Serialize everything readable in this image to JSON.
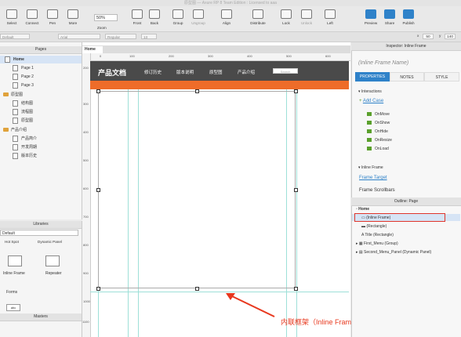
{
  "window": {
    "title": "原型图 — Axure RP 8 Team Edition : Licensed to aaa"
  },
  "toolbar": {
    "items": [
      {
        "label": "Select"
      },
      {
        "label": "Connect"
      },
      {
        "label": "Pen"
      },
      {
        "label": "More"
      },
      {
        "label": "Zoom"
      },
      {
        "label": "Front"
      },
      {
        "label": "Back"
      },
      {
        "label": "Group"
      },
      {
        "label": "Ungroup"
      },
      {
        "label": "Align"
      },
      {
        "label": "Distribute"
      },
      {
        "label": "Lock"
      },
      {
        "label": "Unlock"
      },
      {
        "label": "Left"
      },
      {
        "label": "Preview"
      },
      {
        "label": "Share"
      },
      {
        "label": "Publish"
      }
    ],
    "zoom_value": "50%"
  },
  "formatbar": {
    "style": "Default",
    "font": "Arial",
    "weight": "Regular",
    "size": "13",
    "x_label": "x",
    "x_value": "50",
    "y_label": "y",
    "y_value": "140"
  },
  "pages_panel": {
    "title": "Pages",
    "items": [
      {
        "label": "Home"
      },
      {
        "label": "Page 1"
      },
      {
        "label": "Page 2"
      },
      {
        "label": "Page 3"
      },
      {
        "label": "原型图"
      },
      {
        "label": "结构图"
      },
      {
        "label": "流程图"
      },
      {
        "label": "原型图"
      },
      {
        "label": "产品介绍"
      },
      {
        "label": "产品简介"
      },
      {
        "label": "开发周期"
      },
      {
        "label": "版本历史"
      }
    ]
  },
  "libraries_panel": {
    "title": "Libraries",
    "selected": "Default",
    "row1": [
      "Hot Spot",
      "Dynamic Panel"
    ],
    "row2": [
      "Inline Frame",
      "Repeater"
    ],
    "forms_label": "Forms",
    "forms_item": "abc"
  },
  "masters_panel": {
    "title": "Masters"
  },
  "canvas": {
    "tab": "Home",
    "ruler_h": [
      "0",
      "100",
      "200",
      "300",
      "400",
      "500",
      "600"
    ],
    "ruler_v": [
      "200",
      "300",
      "400",
      "500",
      "600",
      "700",
      "800",
      "900",
      "1000",
      "1100",
      "1200"
    ],
    "site": {
      "logo": "产品文档",
      "nav": [
        "修订历史",
        "版本说明",
        "原型图",
        "产品介绍"
      ],
      "search": "Search"
    },
    "callout": "内联框架（Inline Frame）"
  },
  "inspector": {
    "title": "Inspector: Inline Frame",
    "name_placeholder": "(Inline Frame Name)",
    "tabs": [
      "PROPERTIES",
      "NOTES",
      "STYLE"
    ],
    "interactions_label": "Interactions",
    "add_case": "Add Case",
    "events": [
      "OnMove",
      "OnShow",
      "OnHide",
      "OnResize",
      "OnLoad"
    ],
    "inline_frame_label": "Inline Frame",
    "frame_target": "Frame Target",
    "frame_scrollbars": "Frame Scrollbars"
  },
  "outline": {
    "title": "Outline: Page",
    "items": [
      {
        "label": "Home"
      },
      {
        "label": "(Inline Frame)"
      },
      {
        "label": "(Rectangle)"
      },
      {
        "label": "Title (Rectangle)"
      },
      {
        "label": "First_Menu (Group)"
      },
      {
        "label": "Second_Menu_Panel (Dynamic Panel)"
      }
    ]
  },
  "colors": {
    "accent": "#2f82c9",
    "header": "#4a4a4a",
    "orange": "#ee6c29",
    "callout": "#e8381e"
  }
}
